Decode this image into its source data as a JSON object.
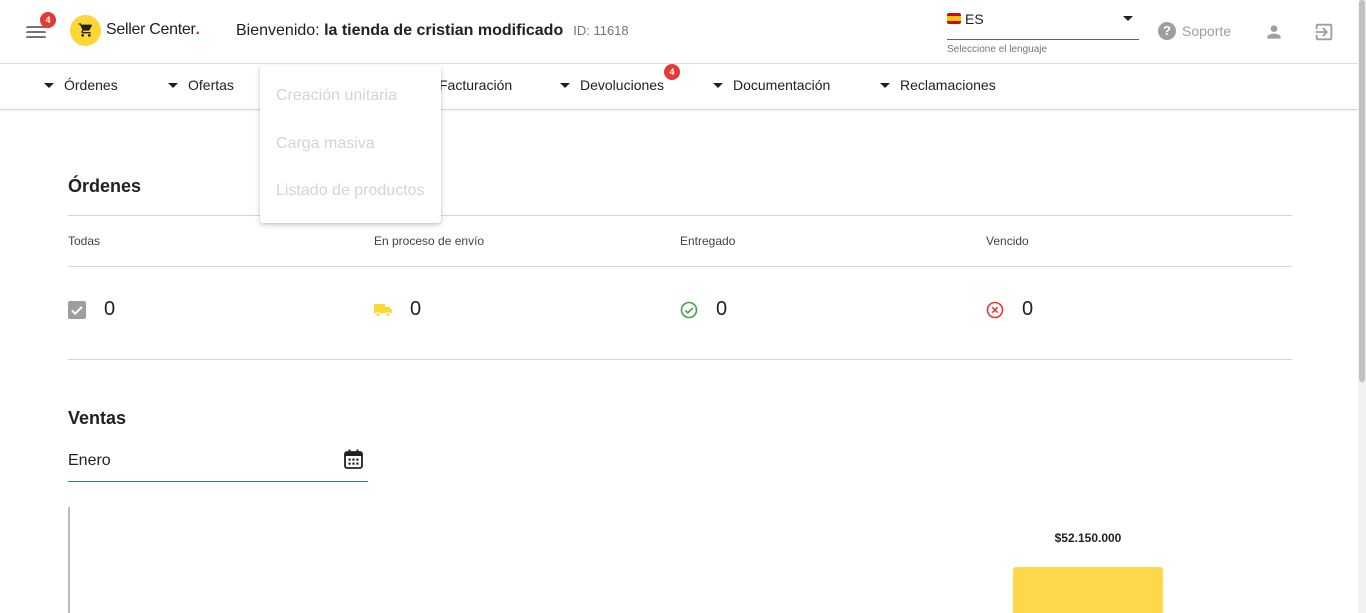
{
  "header": {
    "menu_badge": "4",
    "logo_text": "Seller Center",
    "welcome_prefix": "Bienvenido: ",
    "store_name": "la tienda de cristian modificado",
    "store_id": "ID: 11618",
    "language": {
      "code": "ES",
      "helper": "Seleccione el lenguaje"
    },
    "support_label": "Soporte"
  },
  "nav": {
    "items": [
      {
        "label": "Órdenes"
      },
      {
        "label": "Ofertas"
      },
      {
        "label": "Facturación"
      },
      {
        "label": "Devoluciones",
        "badge": "4"
      },
      {
        "label": "Documentación"
      },
      {
        "label": "Reclamaciones"
      }
    ]
  },
  "dropdown": {
    "items": [
      "Creación unitaria",
      "Carga masiva",
      "Listado de productos"
    ]
  },
  "orders": {
    "title": "Órdenes",
    "columns": [
      {
        "label": "Todas",
        "value": "0",
        "icon": "checkbox-icon",
        "color": "#9e9e9e"
      },
      {
        "label": "En proceso de envío",
        "value": "0",
        "icon": "truck-icon",
        "color": "#fdd835"
      },
      {
        "label": "Entregado",
        "value": "0",
        "icon": "check-circle-icon",
        "color": "#43a047"
      },
      {
        "label": "Vencido",
        "value": "0",
        "icon": "cancel-circle-icon",
        "color": "#e53935"
      }
    ]
  },
  "sales": {
    "title": "Ventas",
    "month": "Enero",
    "bar_value_label": "$52.150.000",
    "bar_color": "#fdd84a"
  }
}
